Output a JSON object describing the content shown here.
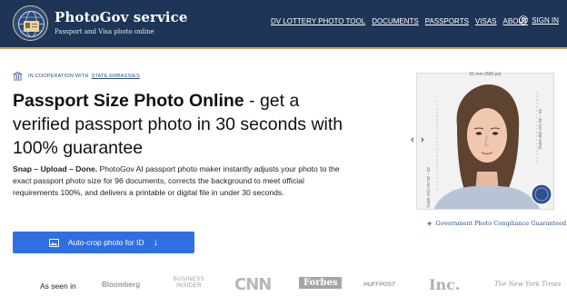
{
  "brand": {
    "title": "PhotoGov service",
    "subtitle": "Passport and Visa photo online"
  },
  "nav": {
    "items": [
      "DV LOTTERY PHOTO TOOL",
      "DOCUMENTS",
      "PASSPORTS",
      "VISAS",
      "ABOUT"
    ],
    "signin": "SIGN IN"
  },
  "hero": {
    "coop_prefix": "IN COOPERATION WITH",
    "coop_link": "STATE EMBASSIES",
    "headline_bold": "Passport Size Photo Online",
    "headline_rest": " - get a verified passport photo in 30 seconds with 100% guarantee",
    "desc_bold": "Snap – Upload – Done.",
    "desc_rest": " PhotoGov AI passport photo maker instantly adjusts your photo to the exact passport photo size for 96 documents, corrects the background to meet official requirements 100%, and delivers a printable or digital file in under 30 seconds.",
    "cta_label": "Auto-crop photo for ID",
    "photo_dim_top": "51 mm (600 px)",
    "photo_dim_side_left": "25 – 35 mm (16–60%)",
    "photo_dim_side_right": "25 – 35 mm (50–60%)",
    "verified_label": "Government Photo Compliance Guaranteed"
  },
  "press": {
    "label": "As seen in",
    "logos": [
      "Bloomberg",
      "BUSINESS INSIDER",
      "CNN",
      "Forbes",
      "HUFFPOST",
      "Inc.",
      "The New York Times"
    ]
  },
  "colors": {
    "header_bg": "#1f3557",
    "accent_gold": "#c9a35a",
    "cta_blue": "#2f6fe4"
  }
}
